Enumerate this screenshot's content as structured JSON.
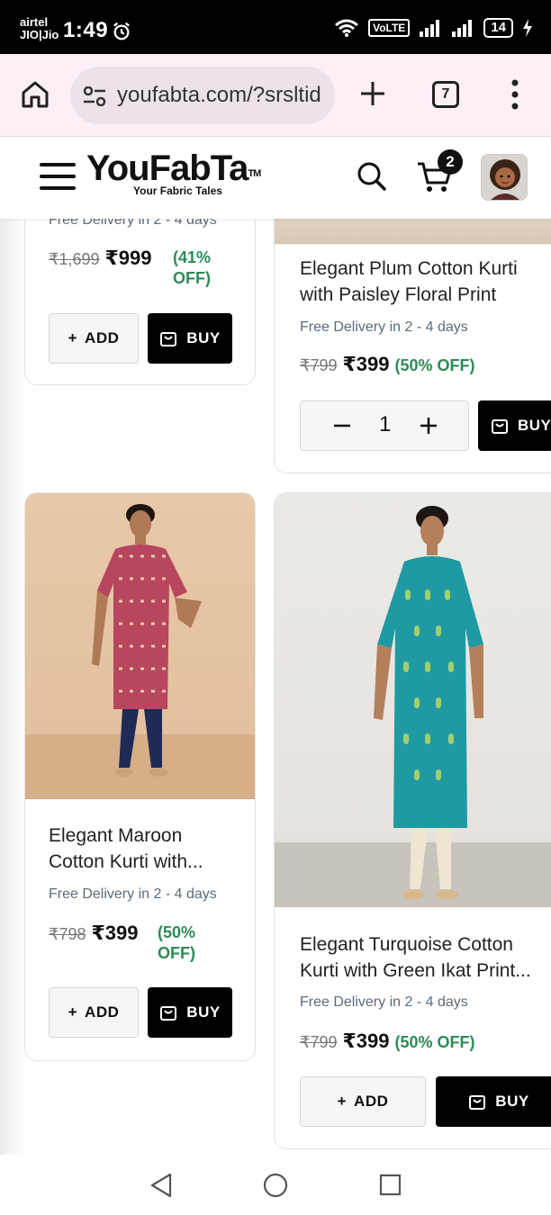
{
  "status_bar": {
    "carrier_line1": "airtel",
    "carrier_line2": "JIO|Jio",
    "time": "1:49",
    "volte": "VoLTE",
    "battery": "14"
  },
  "browser": {
    "url": "youfabta.com/?srsltid",
    "tab_count": "7"
  },
  "site": {
    "logo": "YouFabTa",
    "logo_tm": "TM",
    "tagline": "Your Fabric Tales",
    "cart_count": "2"
  },
  "products": [
    {
      "delivery": "Free Delivery in 2 - 4 days",
      "old_price": "₹1,699",
      "price": "₹999",
      "discount_line1": "(41%",
      "discount_line2": "OFF)",
      "add_label": "ADD",
      "buy_label": "BUY"
    },
    {
      "title": "Elegant Plum Cotton Kurti with Paisley Floral Print",
      "delivery": "Free Delivery in 2 - 4 days",
      "old_price": "₹799",
      "price": "₹399",
      "discount": "(50% OFF)",
      "quantity": "1",
      "buy_label": "BUY"
    },
    {
      "title": "Elegant Maroon Cotton Kurti with...",
      "delivery": "Free Delivery in 2 - 4 days",
      "old_price": "₹798",
      "price": "₹399",
      "discount_line1": "(50%",
      "discount_line2": "OFF)",
      "add_label": "ADD",
      "buy_label": "BUY"
    },
    {
      "title": "Elegant Turquoise Cotton Kurti with Green Ikat Print...",
      "delivery": "Free Delivery in 2 - 4 days",
      "old_price": "₹799",
      "price": "₹399",
      "discount": "(50% OFF)",
      "add_label": "ADD",
      "buy_label": "BUY"
    }
  ],
  "colors": {
    "discount_green": "#2e8b57",
    "delivery_text": "#5a6b7a",
    "buy_button": "#000000",
    "browser_bar": "#fcf0f6"
  }
}
